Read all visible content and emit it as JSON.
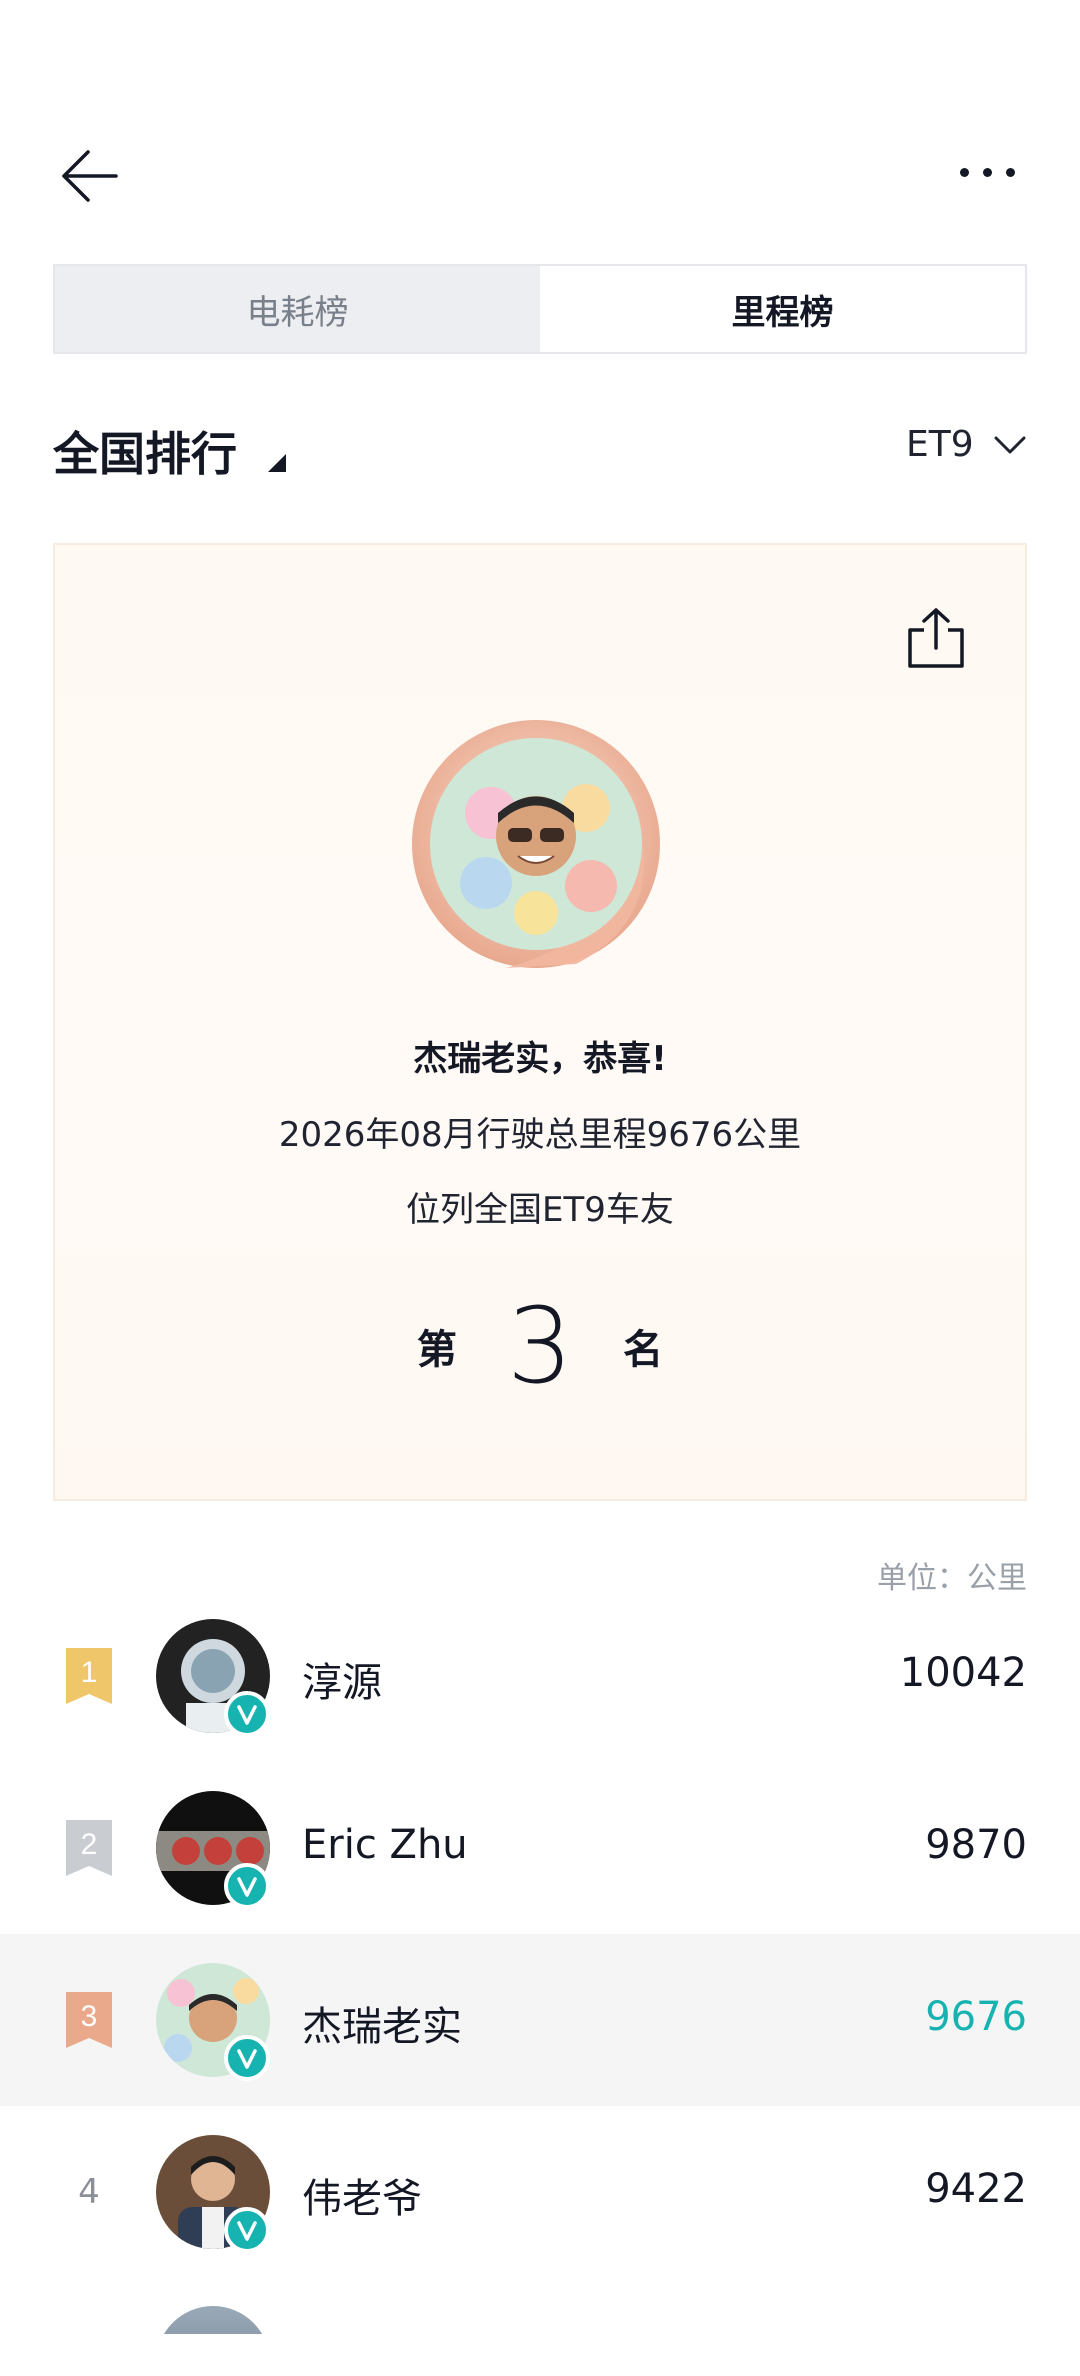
{
  "header": {
    "back_icon": "arrow-left-icon",
    "more_icon": "more-horizontal-icon"
  },
  "tabs": [
    {
      "label": "电耗榜",
      "active": false
    },
    {
      "label": "里程榜",
      "active": true
    }
  ],
  "section": {
    "title": "全国排行",
    "model": "ET9"
  },
  "card": {
    "share_icon": "share-icon",
    "congrats": "杰瑞老实，恭喜!",
    "summary": "2026年08月行驶总里程9676公里",
    "scope": "位列全国ET9车友",
    "rank_prefix": "第",
    "rank": "3",
    "rank_suffix": "名"
  },
  "unit_label": "单位：公里",
  "ranking": [
    {
      "rank": "1",
      "name": "淳源",
      "value": "10042",
      "self": false
    },
    {
      "rank": "2",
      "name": "Eric Zhu",
      "value": "9870",
      "self": false
    },
    {
      "rank": "3",
      "name": "杰瑞老实",
      "value": "9676",
      "self": true
    },
    {
      "rank": "4",
      "name": "伟老爷",
      "value": "9422",
      "self": false
    }
  ],
  "colors": {
    "accent": "#17b3b0",
    "gold": "#f0c66b",
    "silver": "#c9cdd2",
    "bronze": "#eaa98a",
    "card_bg": "#fff9f3"
  }
}
